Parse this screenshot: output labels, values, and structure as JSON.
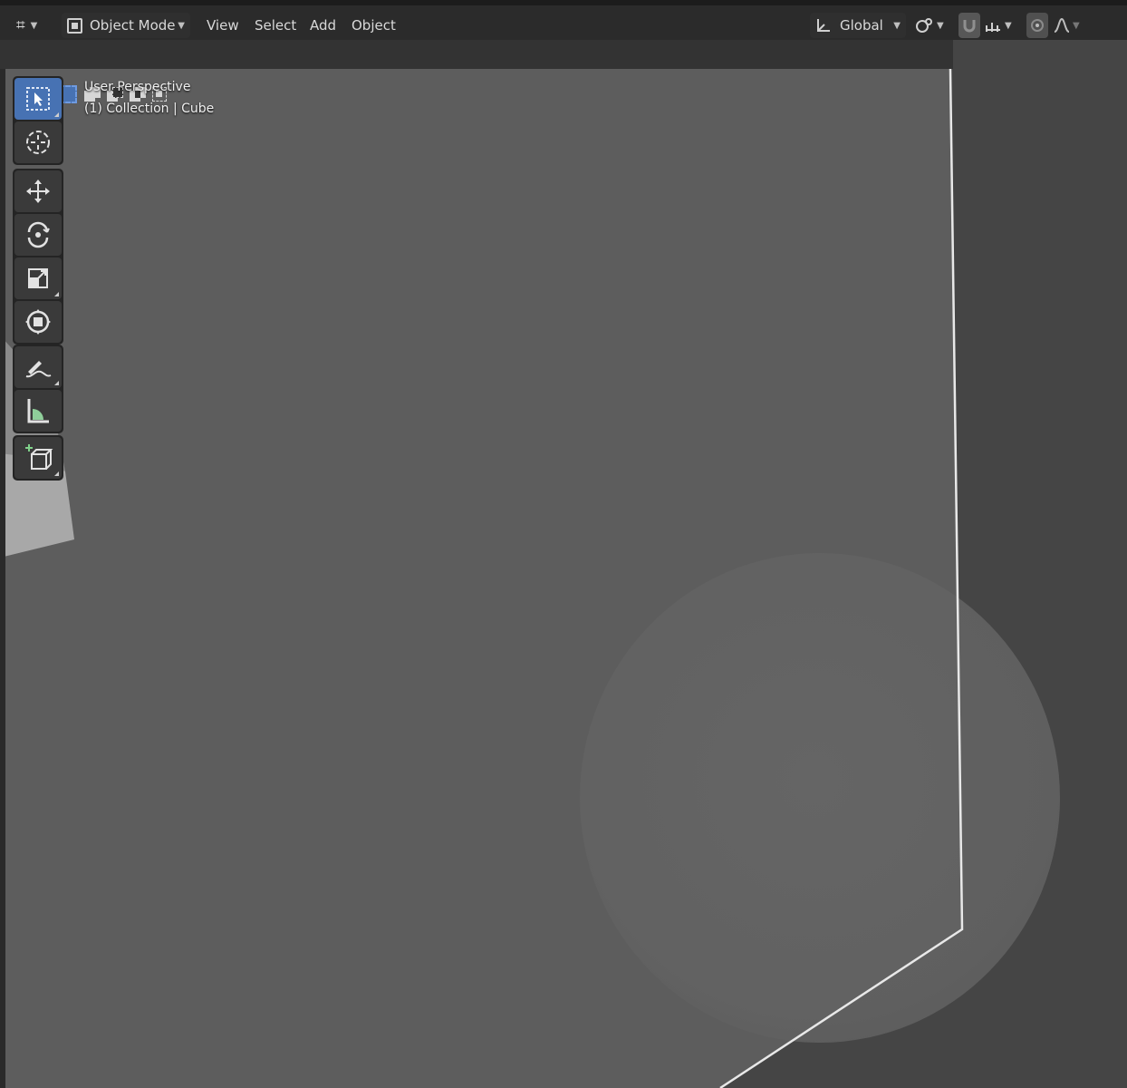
{
  "header": {
    "editor_type_icon": "transform-axes-icon",
    "mode_label": "Object Mode",
    "mode_icon": "object-mode-icon",
    "menus": [
      "View",
      "Select",
      "Add",
      "Object"
    ],
    "orientation_label": "Global",
    "orientation_icon": "transform-orientation-icon",
    "pivot_icon": "pivot-point-icon",
    "snap_icon": "snap-magnet-icon",
    "snap_target_icon": "snap-increment-icon",
    "proportional_icon": "proportional-editing-icon",
    "falloff_icon": "falloff-curve-icon"
  },
  "tool_settings": {
    "selection_modes": [
      "select-new-icon",
      "select-extend-icon",
      "select-subtract-icon",
      "select-difference-icon",
      "select-intersect-icon"
    ]
  },
  "viewport": {
    "view_name": "User Perspective",
    "collection_info": "(1) Collection | Cube"
  },
  "toolbar": {
    "groups": [
      [
        "select-box-icon",
        "cursor-icon"
      ],
      [
        "move-icon",
        "rotate-icon",
        "scale-icon",
        "transform-icon"
      ],
      [
        "annotate-icon",
        "measure-icon"
      ],
      [
        "add-cube-icon"
      ]
    ]
  },
  "colors": {
    "active_tool": "#4772b3",
    "header_bg": "#2b2b2b",
    "viewport_bg": "#454545",
    "cube_face": "#5e5e5e",
    "selection_outline": "#e8e8e8"
  }
}
